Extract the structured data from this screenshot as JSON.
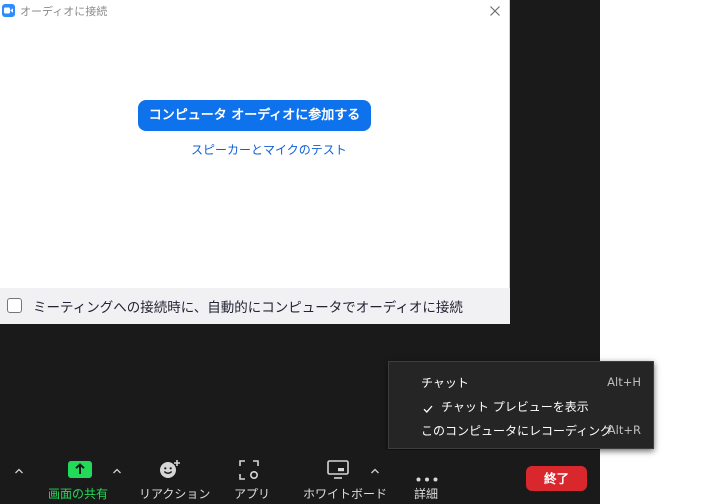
{
  "dialog": {
    "title": "オーディオに接続",
    "join_button": "コンピュータ オーディオに参加する",
    "test_link": "スピーカーとマイクのテスト",
    "auto_join_label": "ミーティングへの接続時に、自動的にコンピュータでオーディオに接続",
    "auto_join_checked": false
  },
  "menu": {
    "items": [
      {
        "label": "チャット",
        "shortcut": "Alt+H",
        "checked": false
      },
      {
        "label": "チャット プレビューを表示",
        "shortcut": "",
        "checked": true
      },
      {
        "label": "このコンピュータにレコーディング",
        "shortcut": "Alt+R",
        "checked": false
      }
    ]
  },
  "toolbar": {
    "share_label": "画面の共有",
    "reactions_label": "リアクション",
    "apps_label": "アプリ",
    "whiteboard_label": "ホワイトボード",
    "more_label": "詳細",
    "end_label": "終了"
  },
  "colors": {
    "accent": "#0e72ed",
    "share_green": "#23d959",
    "end_red": "#d9272e",
    "toolbar_bg": "#1a1a1a"
  }
}
